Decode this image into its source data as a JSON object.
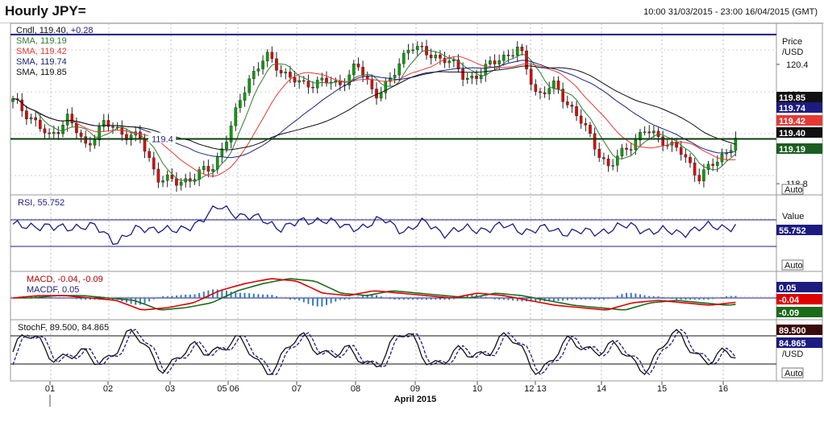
{
  "window": {
    "title": "Hourly JPY=",
    "date_range": "10:00 31/03/2015 - 23:00 16/04/2015 (GMT)"
  },
  "colors": {
    "candle_up": "#00a000",
    "candle_down": "#e00000",
    "sma1": "#2e7d32",
    "sma2": "#e53935",
    "sma3": "#1a237e",
    "sma4": "#111111",
    "navy": "#1c1c80",
    "macd": "#e00000",
    "signal": "#1b6b1b",
    "hist": "#3a7ab8"
  },
  "price_panel": {
    "legend": [
      {
        "name": "Cndl",
        "value": "119.40",
        "change": "+0.28"
      },
      {
        "name": "SMA",
        "value": "119.19"
      },
      {
        "name": "SMA",
        "value": "119.42"
      },
      {
        "name": "SMA",
        "value": "119.74"
      },
      {
        "name": "SMA",
        "value": "119.85"
      }
    ],
    "axis_title": "Price\n/USD",
    "ticks": [
      "120.4",
      "120",
      "118.8"
    ],
    "hline_label": "119.4",
    "tags": [
      "119.85",
      "119.74",
      "119.42",
      "119.40",
      "119.19"
    ],
    "auto": "Auto"
  },
  "rsi_panel": {
    "legend": "RSI, 55.752",
    "axis_title": "Value",
    "tag": "55.752",
    "auto": "Auto"
  },
  "macd_panel": {
    "legend_macd": "MACD, -0.04, -0.09",
    "legend_macdf": "MACDF, 0.05",
    "tags": [
      "0.05",
      "-0.04",
      "-0.09"
    ],
    "auto": "Auto"
  },
  "stoch_panel": {
    "legend": "StochF, 89.500, 84.865",
    "axis_title": "/USD",
    "tags": [
      "89.500",
      "84.865"
    ],
    "auto": "Auto"
  },
  "x_axis": {
    "labels": [
      "01",
      "02",
      "03",
      "05 06",
      "07",
      "08",
      "09",
      "10",
      "12 13",
      "14",
      "15",
      "16"
    ],
    "month": "April 2015"
  },
  "chart_data": {
    "type": "candlestick",
    "title": "Hourly JPY=",
    "xlabel": "April 2015",
    "ylabel": "Price /USD",
    "x": [
      "31/03",
      "01",
      "02",
      "03",
      "05",
      "07",
      "08",
      "09",
      "10",
      "13",
      "14",
      "15",
      "16"
    ],
    "close_path": [
      119.9,
      119.7,
      119.4,
      119.7,
      119.3,
      119.6,
      119.5,
      119.4,
      118.9,
      118.8,
      118.9,
      119.0,
      119.5,
      120.2,
      120.5,
      120.3,
      120.1,
      120.2,
      120.1,
      120.4,
      120.0,
      120.2,
      120.7,
      120.5,
      120.5,
      120.2,
      120.3,
      120.5,
      120.6,
      120.0,
      120.1,
      119.8,
      119.4,
      119.0,
      119.3,
      119.5,
      119.4,
      119.2,
      118.9,
      119.1,
      119.4
    ],
    "hlines": [
      120.8,
      119.4
    ],
    "sma": [
      {
        "name": "SMA",
        "last": 119.19
      },
      {
        "name": "SMA",
        "last": 119.42
      },
      {
        "name": "SMA",
        "last": 119.74
      },
      {
        "name": "SMA",
        "last": 119.85
      }
    ],
    "ylim": [
      118.65,
      120.95
    ],
    "rsi": {
      "last": 55.752,
      "path": [
        55,
        57,
        53,
        56,
        54,
        44,
        52,
        55,
        50,
        60,
        70,
        65,
        60,
        55,
        58,
        62,
        54,
        56,
        60,
        52,
        58,
        50,
        53,
        54,
        55,
        52,
        53,
        51,
        50,
        54,
        55,
        52,
        50,
        53,
        55,
        56
      ]
    },
    "macd": {
      "macd": -0.04,
      "signal": -0.09,
      "hist": 0.05
    },
    "stochf": {
      "k": 89.5,
      "d": 84.865
    }
  }
}
